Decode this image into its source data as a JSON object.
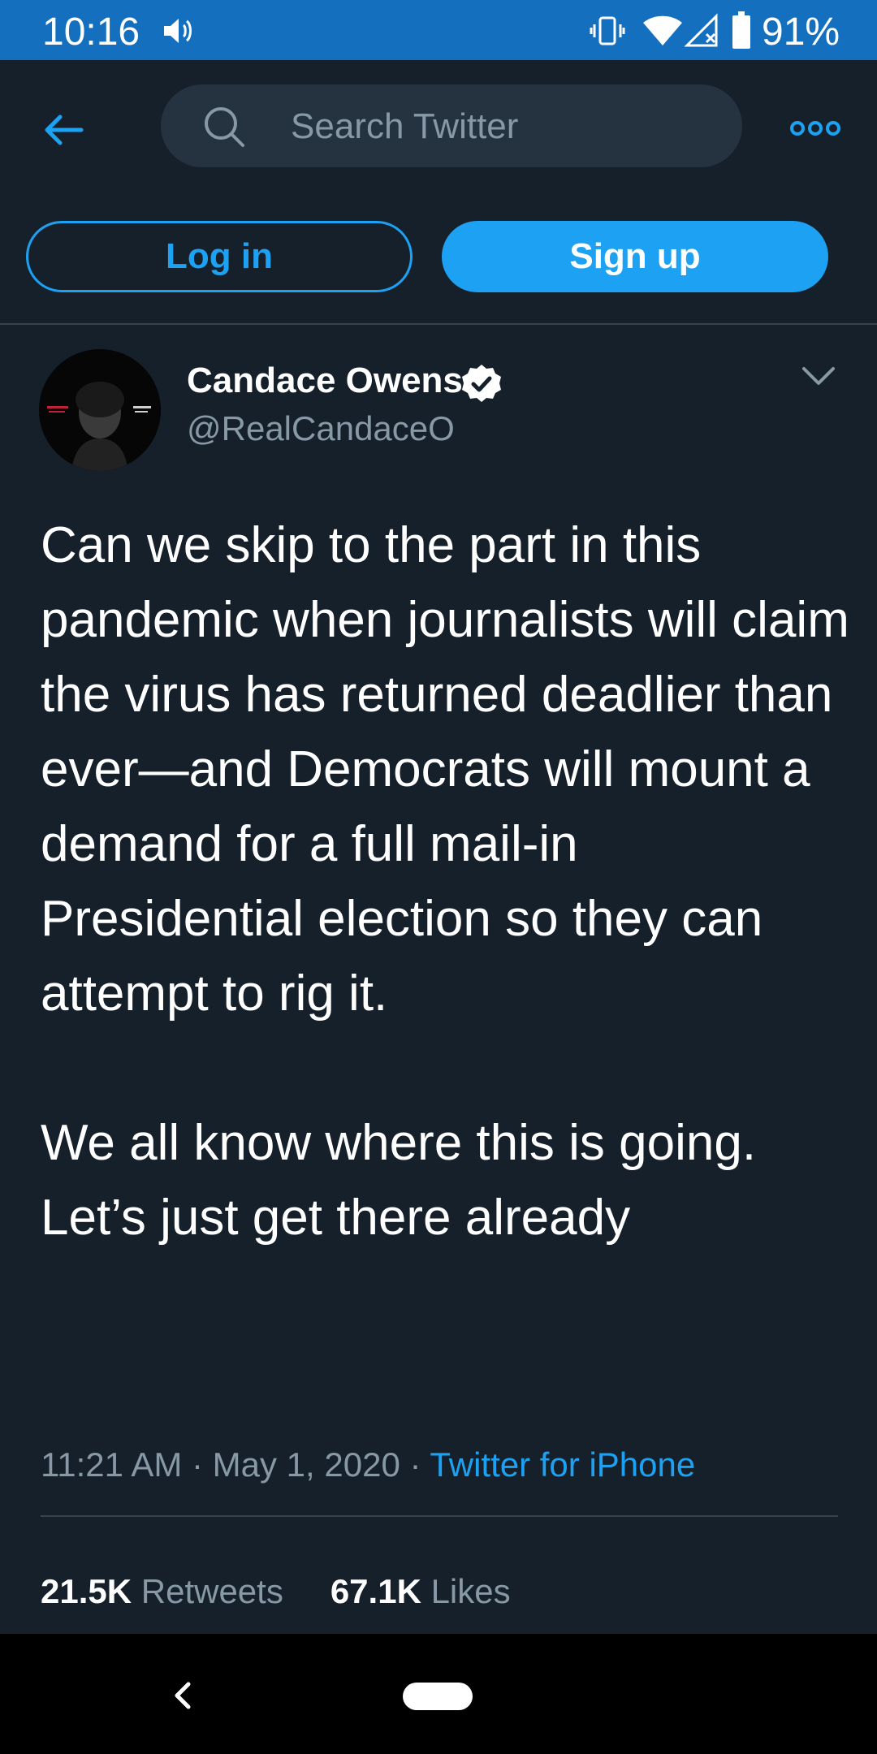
{
  "status_bar": {
    "time": "10:16",
    "battery_percent": "91%"
  },
  "header": {
    "search_placeholder": "Search Twitter",
    "login_label": "Log in",
    "signup_label": "Sign up"
  },
  "tweet": {
    "author_name": "Candace Owens",
    "handle": "@RealCandaceO",
    "verified": true,
    "text": "Can we skip to the part in this pandemic when journalists will claim the virus has returned deadlier than ever—and Democrats will mount a demand for a full mail-in Presidential election so they can attempt to rig it.\n\nWe all know where this is going. Let’s just get there already",
    "time": "11:21 AM",
    "date": "May 1, 2020",
    "separator": " · ",
    "source": "Twitter for iPhone",
    "retweets_count": "21.5K",
    "retweets_label": "Retweets",
    "likes_count": "67.1K",
    "likes_label": "Likes"
  },
  "colors": {
    "background": "#15202b",
    "status_bar": "#1470bf",
    "accent": "#1da1f2",
    "secondary_text": "#8899a6",
    "search_bg": "#253341",
    "divider": "#38444d"
  },
  "icons": [
    "volume-icon",
    "vibrate-icon",
    "wifi-icon",
    "cellular-icon",
    "battery-icon",
    "back-arrow-icon",
    "search-icon",
    "more-icon",
    "verified-badge-icon",
    "chevron-down-icon",
    "nav-back-icon"
  ]
}
